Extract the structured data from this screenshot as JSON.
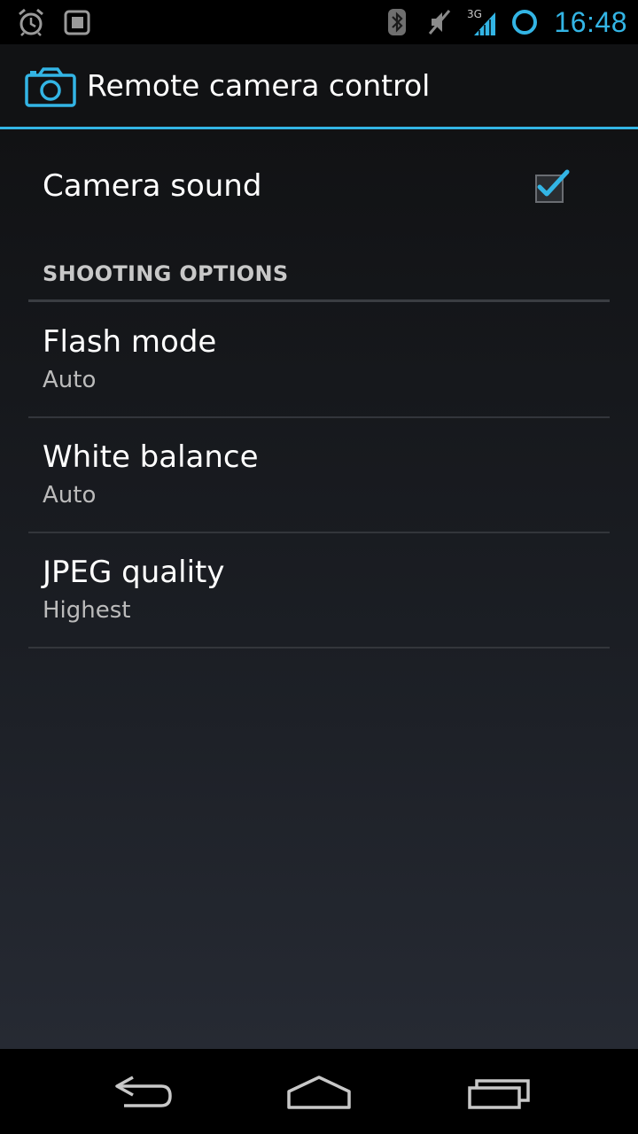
{
  "status_bar": {
    "time": "16:48",
    "network": "3G",
    "icons": [
      "alarm-icon",
      "notification-icon",
      "bluetooth-icon",
      "mute-icon",
      "signal-icon",
      "sync-icon"
    ],
    "accent": "#33b5e5"
  },
  "action_bar": {
    "icon": "camera-icon",
    "title": "Remote camera control"
  },
  "preferences": {
    "camera_sound": {
      "title": "Camera sound",
      "checked": true
    },
    "category": {
      "label": "SHOOTING OPTIONS"
    },
    "items": [
      {
        "title": "Flash mode",
        "summary": "Auto"
      },
      {
        "title": "White balance",
        "summary": "Auto"
      },
      {
        "title": "JPEG quality",
        "summary": "Highest"
      }
    ]
  },
  "nav_bar": {
    "buttons": [
      "back-icon",
      "home-icon",
      "recent-apps-icon"
    ]
  },
  "colors": {
    "accent": "#33b5e5",
    "text_primary": "#ffffff",
    "text_secondary": "#bbbbbb"
  }
}
